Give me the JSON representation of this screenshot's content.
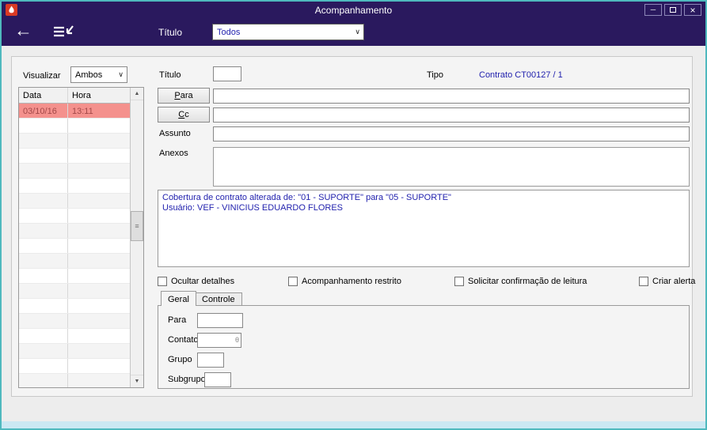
{
  "window": {
    "title": "Acompanhamento"
  },
  "icons": {
    "back": "←",
    "close": "×",
    "minimize": "─",
    "chevron_down": "∨",
    "scroll_up": "▲",
    "scroll_down": "▼",
    "grip": "≡",
    "contato_lookup": "θ"
  },
  "toolbar": {
    "titulo_label": "Título",
    "filter_value": "Todos"
  },
  "left_panel": {
    "visualizar_label": "Visualizar",
    "visualizar_value": "Ambos",
    "table": {
      "col_data": "Data",
      "col_hora": "Hora",
      "selected_row": {
        "data": "03/10/16",
        "hora": "13:11"
      }
    }
  },
  "form": {
    "titulo_label": "Título",
    "titulo_value": "",
    "tipo_label": "Tipo",
    "tipo_value": "Contrato CT00127 / 1",
    "para_button": "Para",
    "cc_button": "Cc",
    "assunto_label": "Assunto",
    "assunto_value": "",
    "anexos_label": "Anexos",
    "message_line1": "Cobertura de contrato alterada de: \"01 - SUPORTE\" para \"05 - SUPORTE\"",
    "message_line2": "Usuário: VEF - VINICIUS EDUARDO FLORES",
    "checkboxes": {
      "ocultar": "Ocultar detalhes",
      "restrito": "Acompanhamento restrito",
      "confirmacao": "Solicitar confirmação de leitura",
      "alerta": "Criar alerta"
    },
    "tabs": {
      "geral": "Geral",
      "controle": "Controle"
    },
    "detail": {
      "para_label": "Para",
      "contato_label": "Contato",
      "grupo_label": "Grupo",
      "subgrupo_label": "Subgrupo"
    }
  },
  "colors": {
    "titlebar_bg": "#2a195e",
    "frame_border": "#4fb9be",
    "selected_row_bg": "#f4918d",
    "selected_row_text": "#a34848",
    "link_blue": "#2222ae",
    "bottom_strip": "#cbe8f3"
  }
}
